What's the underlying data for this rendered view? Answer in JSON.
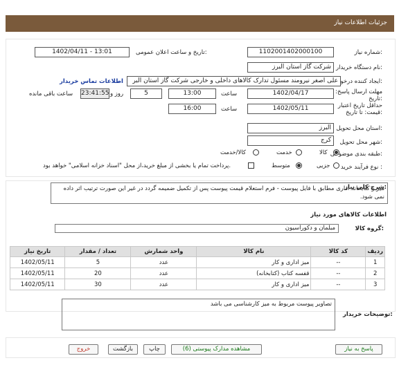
{
  "header": {
    "title": "جزئیات اطلاعات نیاز"
  },
  "fields": {
    "need_number_label": "شماره نیاز:",
    "need_number": "1102001402000100",
    "announce_label": "تاریخ و ساعت اعلان عمومی:",
    "announce_value": "1402/04/11 - 13:01",
    "buyer_org_label": "نام دستگاه خریدار:",
    "buyer_org": "شرکت گاز استان البرز",
    "requester_label": "ایجاد کننده درخواست:",
    "requester": "علی اصغر نیرومند مسئول تدارک کالاهای داخلی و خارجی شرکت گاز استان البر",
    "contact_link": "اطلاعات تماس خریدار",
    "deadline_label": "مهلت ارسال پاسخ: تا تاریخ:",
    "deadline_date": "1402/04/17",
    "time_label": "ساعت",
    "deadline_time": "13:00",
    "days_value": "5",
    "days_label": "روز و",
    "remaining_time": "23:41:55",
    "remaining_label": "ساعت باقی مانده",
    "min_price_label": "حداقل تاریخ اعتبار قیمت: تا تاریخ:",
    "min_price_date": "1402/05/11",
    "min_price_time_label": "ساعت",
    "min_price_time": "16:00",
    "province_label": "استان محل تحویل:",
    "province": "البرز",
    "city_label": "شهر محل تحویل:",
    "city": "کرج",
    "category_label": "طبقه بندی موضوعی:",
    "category_options": [
      "کالا",
      "خدمت",
      "کالا/خدمت"
    ],
    "process_label": "نوع فرآیند خرید :",
    "process_options": [
      "جزیی",
      "متوسط"
    ],
    "payment_note": "پرداخت تمام یا بخشی از مبلغ خرید،از محل \"اسناد خزانه اسلامی\" خواهد بود."
  },
  "description": {
    "label": "شرح کلی نیاز:",
    "text": "میز و کتابخانه اداری مطابق با فایل پیوست - فرم استعلام قیمت پیوست پس از تکمیل ضمیمه گردد در غیر این صورت ترتیب اثر داده نمی شود."
  },
  "goods": {
    "section_title": "اطلاعات کالاهای مورد نیاز",
    "group_label": "گروه کالا:",
    "group_value": "مبلمان و دکوراسیون",
    "columns": [
      "ردیف",
      "کد کالا",
      "نام کالا",
      "واحد شمارش",
      "تعداد / مقدار",
      "تاریخ نیاز"
    ],
    "rows": [
      {
        "row": "1",
        "code": "--",
        "name": "میز اداری و کار",
        "unit": "عدد",
        "qty": "5",
        "date": "1402/05/11"
      },
      {
        "row": "2",
        "code": "--",
        "name": "قفسه کتاب (کتابخانه)",
        "unit": "عدد",
        "qty": "20",
        "date": "1402/05/11"
      },
      {
        "row": "3",
        "code": "--",
        "name": "میز اداری و کار",
        "unit": "عدد",
        "qty": "30",
        "date": "1402/05/11"
      }
    ]
  },
  "notes": {
    "label": "توضیحات خریدار:",
    "text": "تصاویر پیوست مربوط به میز کارشناسی می باشد"
  },
  "buttons": {
    "reply": "پاسخ به نیاز",
    "attachments": "مشاهده مدارک پیوستی (6)",
    "print": "چاپ",
    "back": "بازگشت",
    "exit": "خروج"
  },
  "colors": {
    "header": "#7a5a3b",
    "link": "#1a3c9f",
    "exit": "#c0392b",
    "green": "#1a7a1a"
  }
}
